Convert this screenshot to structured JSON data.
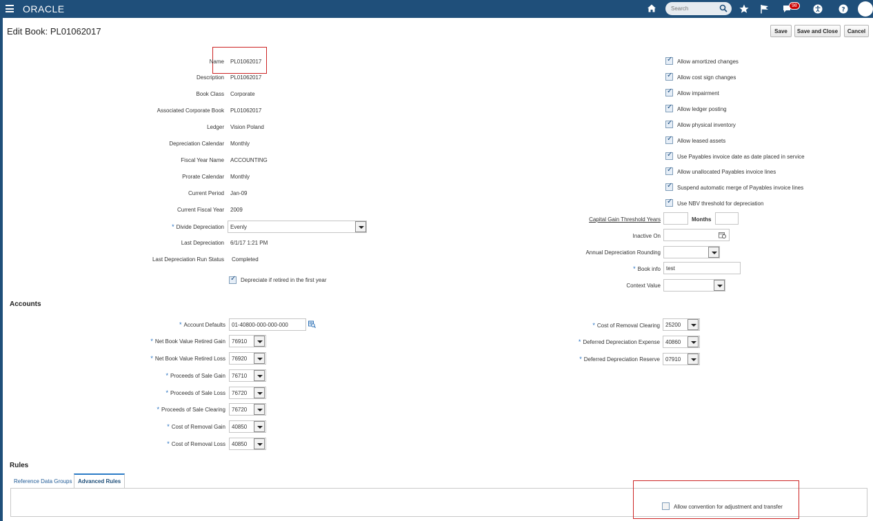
{
  "header": {
    "brand": "ORACLE",
    "search_placeholder": "Search",
    "notification_count": "98"
  },
  "page": {
    "title": "Edit Book: PL01062017"
  },
  "toolbar": {
    "save": "Save",
    "save_close": "Save and Close",
    "cancel": "Cancel"
  },
  "details": [
    {
      "label": "Name",
      "value": "PL01062017"
    },
    {
      "label": "Description",
      "value": "PL01062017"
    },
    {
      "label": "Book Class",
      "value": "Corporate"
    },
    {
      "label": "Associated Corporate Book",
      "value": "PL01062017"
    },
    {
      "label": "Ledger",
      "value": "Vision Poland"
    },
    {
      "label": "Depreciation Calendar",
      "value": "Monthly"
    },
    {
      "label": "Fiscal Year Name",
      "value": "ACCOUNTING"
    },
    {
      "label": "Prorate Calendar",
      "value": "Monthly"
    },
    {
      "label": "Current Period",
      "value": "Jan-09"
    },
    {
      "label": "Current Fiscal Year",
      "value": "2009"
    }
  ],
  "divide_depreciation": {
    "label": "Divide Depreciation",
    "value": "Evenly"
  },
  "last_depreciation": {
    "label": "Last Depreciation",
    "value": "6/1/17 1:21 PM"
  },
  "last_run_status": {
    "label": "Last Depreciation Run Status",
    "value": "Completed"
  },
  "depreciate_if_retired": {
    "label": "Depreciate if retired in the first year",
    "checked": true
  },
  "right_checkboxes": [
    {
      "label": "Allow amortized changes",
      "checked": true
    },
    {
      "label": "Allow cost sign changes",
      "checked": true
    },
    {
      "label": "Allow impairment",
      "checked": true
    },
    {
      "label": "Allow ledger posting",
      "checked": true
    },
    {
      "label": "Allow physical inventory",
      "checked": true
    },
    {
      "label": "Allow leased assets",
      "checked": true
    },
    {
      "label": "Use Payables invoice date as date placed in service",
      "checked": true
    },
    {
      "label": "Allow unallocated Payables invoice lines",
      "checked": true
    },
    {
      "label": "Suspend automatic merge of Payables invoice lines",
      "checked": true
    },
    {
      "label": "Use NBV threshold for depreciation",
      "checked": true
    }
  ],
  "capital_gain": {
    "label": "Capital Gain Threshold Years",
    "months_label": "Months",
    "years": "",
    "months": ""
  },
  "inactive_on": {
    "label": "Inactive On",
    "value": ""
  },
  "annual_rounding": {
    "label": "Annual Depreciation Rounding",
    "value": ""
  },
  "book_info": {
    "label": "Book info",
    "value": "test"
  },
  "context_value": {
    "label": "Context Value",
    "value": ""
  },
  "accounts": {
    "title": "Accounts",
    "account_defaults": {
      "label": "Account Defaults",
      "value": "01-40800-000-000-000"
    },
    "left": [
      {
        "label": "Net Book Value Retired Gain",
        "value": "76910"
      },
      {
        "label": "Net Book Value Retired Loss",
        "value": "76920"
      },
      {
        "label": "Proceeds of Sale Gain",
        "value": "76710"
      },
      {
        "label": "Proceeds of Sale Loss",
        "value": "76720"
      },
      {
        "label": "Proceeds of Sale Clearing",
        "value": "76720"
      },
      {
        "label": "Cost of Removal Gain",
        "value": "40850"
      },
      {
        "label": "Cost of Removal Loss",
        "value": "40850"
      }
    ],
    "right": [
      {
        "label": "Cost of Removal Clearing",
        "value": "25200"
      },
      {
        "label": "Deferred Depreciation Expense",
        "value": "40860"
      },
      {
        "label": "Deferred Depreciation Reserve",
        "value": "07910"
      }
    ]
  },
  "rules": {
    "title": "Rules",
    "tabs": [
      {
        "label": "Reference Data Groups"
      },
      {
        "label": "Advanced Rules"
      }
    ],
    "allow_convention": {
      "label": "Allow convention for adjustment and transfer",
      "checked": false
    }
  }
}
